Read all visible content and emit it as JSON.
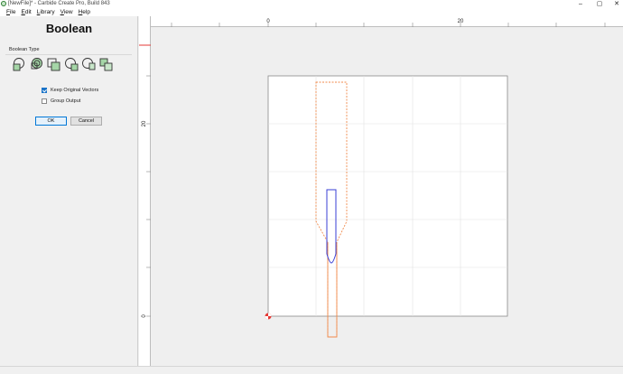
{
  "window": {
    "title": "[NewFile]* - Carbide Create Pro, Build 843",
    "minimize_glyph": "–",
    "maximize_glyph": "▢",
    "close_glyph": "✕"
  },
  "menu": [
    "File",
    "Edit",
    "Library",
    "View",
    "Help"
  ],
  "panel": {
    "title": "Boolean",
    "section_label": "Boolean Type",
    "boolean_types": [
      "union",
      "union-keep-holes",
      "intersect",
      "subtract-a",
      "subtract-b",
      "subtract-c"
    ],
    "keep_original_vectors": {
      "label": "Keep Original Vectors",
      "checked": true
    },
    "group_output": {
      "label": "Group Output",
      "checked": false
    },
    "ok_label": "OK",
    "cancel_label": "Cancel"
  },
  "rulers": {
    "horizontal_ticks": [
      "0",
      "20"
    ],
    "vertical_ticks": [
      "20",
      "0"
    ]
  },
  "colors": {
    "accent": "#1a73c8",
    "origin": "#e53935",
    "shape_orange": "#f08a4b",
    "shape_blue": "#3a3fd6",
    "icon_green": "#3e8e41"
  },
  "icons": {
    "app": "carbide-create-icon",
    "origin": "origin-marker-icon"
  }
}
